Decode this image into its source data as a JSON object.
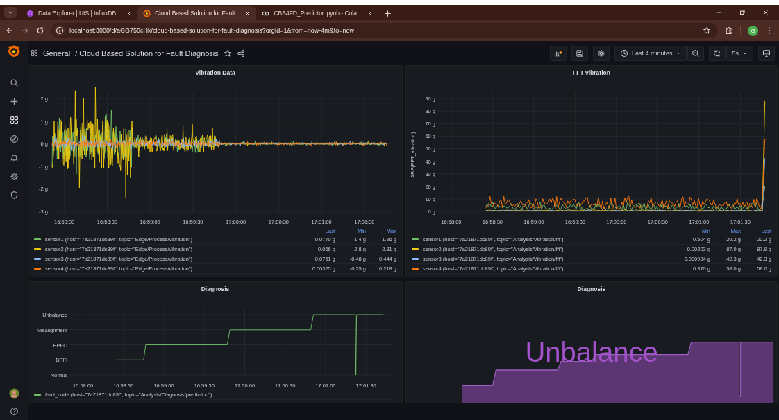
{
  "browser": {
    "tabs": [
      {
        "kind": "influx",
        "title": "Data Explorer | UIS | InfluxDB",
        "selected": false
      },
      {
        "kind": "grafana",
        "title": "Cloud Based Solution for Fault",
        "selected": true
      },
      {
        "kind": "colab",
        "title": "CBS4FD_Predictor.ipynb - Cola",
        "selected": false
      }
    ],
    "url": "localhost:3000/d/aGG750cHk/cloud-based-solution-for-fault-diagnosis?orgId=1&from=now-4m&to=now",
    "profile_initial": "G"
  },
  "header": {
    "folder": "General",
    "title": "/ Cloud Based Solution for Fault Diagnosis",
    "time_range": "Last 4 minutes",
    "refresh": "5s"
  },
  "panels": [
    {
      "kind": "vibration",
      "title": "Vibration Data",
      "y_ticks": [
        "2 g",
        "1 g",
        "0 g",
        "-1 g",
        "-2 g",
        "-3 g"
      ],
      "x_ticks": [
        "16:58:00",
        "16:58:30",
        "16:59:00",
        "16:59:30",
        "17:00:00",
        "17:00:30",
        "17:01:00",
        "17:01:30"
      ],
      "legend": {
        "columns": [
          "Last",
          "Min",
          "Max"
        ],
        "rows": [
          {
            "name": "sensor1 (host=\"7a21871dc89f\", topic=\"Edge/Process/vibration\")",
            "color": "#73bf69",
            "values": [
              "0.0770 g",
              "-1.4 g",
              "1.96 g"
            ]
          },
          {
            "name": "sensor2 (host=\"7a21871dc89f\", topic=\"Edge/Process/vibration\")",
            "color": "#f2cc0c",
            "values": [
              "-0.066 g",
              "-2.8 g",
              "2.31 g"
            ]
          },
          {
            "name": "sensor3 (host=\"7a21871dc89f\", topic=\"Edge/Process/vibration\")",
            "color": "#8ab8ff",
            "values": [
              "0.0751 g",
              "-0.48 g",
              "0.444 g"
            ]
          },
          {
            "name": "sensor4 (host=\"7a21871dc89f\", topic=\"Edge/Process/vibration\")",
            "color": "#ff780a",
            "values": [
              "0.00325 g",
              "-0.25 g",
              "0.218 g"
            ]
          }
        ]
      }
    },
    {
      "kind": "fft",
      "title": "FFT vibration",
      "y_label": "ABS(FFT_vibration)",
      "y_ticks": [
        "90 g",
        "80 g",
        "70 g",
        "60 g",
        "50 g",
        "40 g",
        "30 g",
        "20 g",
        "10 g",
        "0 g"
      ],
      "x_ticks": [
        "16:58:00",
        "16:58:30",
        "16:59:00",
        "16:59:30",
        "17:00:00",
        "17:00:30",
        "17:01:00",
        "17:01:30"
      ],
      "legend": {
        "columns": [
          "Min",
          "Max",
          "Last"
        ],
        "rows": [
          {
            "name": "sensor1 (host=\"7a21871dc89f\", topic=\"Analysis/Vibration/fft\")",
            "color": "#73bf69",
            "values": [
              "0.504 g",
              "20.2 g",
              "20.2 g"
            ]
          },
          {
            "name": "sensor2 (host=\"7a21871dc89f\", topic=\"Analysis/Vibration/fft\")",
            "color": "#f2cc0c",
            "values": [
              "0.00203 g",
              "87.9 g",
              "87.9 g"
            ]
          },
          {
            "name": "sensor3 (host=\"7a21871dc89f\", topic=\"Analysis/Vibration/fft\")",
            "color": "#8ab8ff",
            "values": [
              "0.000934 g",
              "42.3 g",
              "42.3 g"
            ]
          },
          {
            "name": "sensor4 (host=\"7a21871dc89f\", topic=\"Analysis/Vibration/fft\")",
            "color": "#ff780a",
            "values": [
              "0.370 g",
              "58.0 g",
              "58.0 g"
            ]
          }
        ]
      }
    },
    {
      "kind": "diagnosis",
      "title": "Diagnosis",
      "y_ticks": [
        "Unbalance",
        "Misalignment",
        "BPFO",
        "BPFI",
        "Normal"
      ],
      "x_ticks": [
        "16:58:00",
        "16:58:30",
        "16:59:00",
        "16:59:30",
        "17:00:00",
        "17:00:30",
        "17:01:00",
        "17:01:30"
      ],
      "legend": {
        "rows": [
          {
            "name": "fault_code (host=\"7a21871dc89f\", topic=\"Analysis/Diagnosis/prediction\")",
            "color": "#73bf69"
          }
        ]
      }
    },
    {
      "kind": "stat",
      "title": "Diagnosis",
      "value": "Unbalance"
    }
  ]
}
